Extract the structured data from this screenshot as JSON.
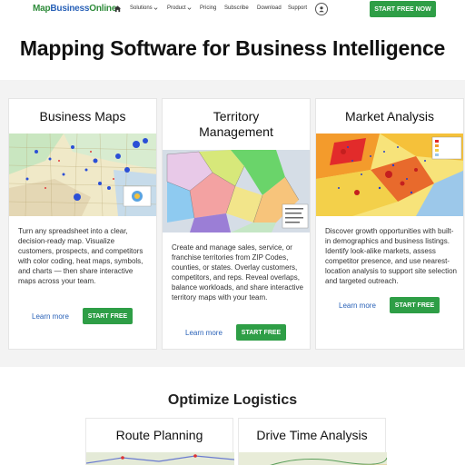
{
  "nav": {
    "logo_part1": "Map",
    "logo_part2": "Business",
    "logo_part3": "Online",
    "items": [
      {
        "label": "Solutions",
        "has_dropdown": true
      },
      {
        "label": "Product",
        "has_dropdown": true
      },
      {
        "label": "Pricing"
      },
      {
        "label": "Subscribe"
      },
      {
        "label": "Download"
      },
      {
        "label": "Support"
      }
    ],
    "cta": "START FREE NOW",
    "icons": [
      "home-icon",
      "user-icon",
      "chevron-down-icon"
    ]
  },
  "hero": {
    "title": "Mapping Software for Business Intelligence"
  },
  "cards": [
    {
      "title": "Business Maps",
      "description": "Turn any spreadsheet into a clear, decision-ready map. Visualize customers, prospects, and competitors with color coding, heat maps, symbols, and charts — then share interactive maps across your team.",
      "learn_more": "Learn more",
      "button": "START FREE"
    },
    {
      "title": "Territory Management",
      "description": "Create and manage sales, service, or franchise territories from ZIP Codes, counties, or states. Overlay customers, competitors, and reps. Reveal overlaps, balance workloads, and share interactive territory maps with your team.",
      "learn_more": "Learn more",
      "button": "START FREE"
    },
    {
      "title": "Market Analysis",
      "description": "Discover growth opportunities with built-in demographics and business listings. Identify look-alike markets, assess competitor presence, and use nearest-location analysis to support site selection and targeted outreach.",
      "learn_more": "Learn more",
      "button": "START FREE"
    }
  ],
  "logistics": {
    "title": "Optimize Logistics",
    "cards": [
      {
        "title": "Route Planning"
      },
      {
        "title": "Drive Time Analysis"
      }
    ]
  },
  "colors": {
    "brand_green": "#2e9e46",
    "brand_blue": "#2a62b8",
    "band_gray": "#f3f3f3"
  }
}
